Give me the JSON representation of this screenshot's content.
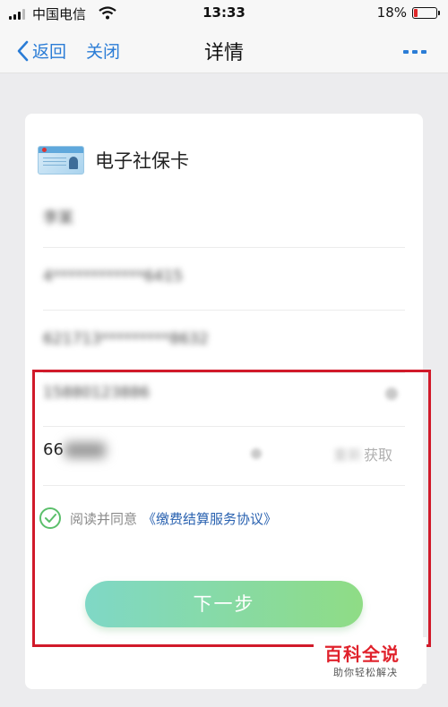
{
  "status_bar": {
    "carrier": "中国电信",
    "time": "13:33",
    "battery": "18%",
    "battery_level": 0.18,
    "signal_icon": "signal-icon",
    "wifi_icon": "wifi-icon",
    "battery_icon": "battery-icon"
  },
  "nav": {
    "back_label": "返回",
    "close_label": "关闭",
    "title": "详情",
    "more_icon": "more-icon"
  },
  "card": {
    "title": "电子社保卡",
    "icon": "social-security-card-icon",
    "name_masked": "李某",
    "id_masked": "4************6415",
    "card_no_masked": "621713*********8632",
    "phone_masked": "15880123886",
    "code_prefix": "66",
    "get_code_label": "获取",
    "get_code_blurred": "重新",
    "agree_text": "阅读并同意",
    "agree_link": "《缴费结算服务协议》",
    "next_label": "下一步"
  },
  "colors": {
    "accent": "#2a7cd6",
    "link": "#2a62b0",
    "highlight": "#d11a2a",
    "button_start": "#7fd8c6",
    "button_end": "#8fdc85",
    "check": "#5bbf6b"
  },
  "watermark": {
    "title": "百科全说",
    "subtitle": "助你轻松解决"
  }
}
